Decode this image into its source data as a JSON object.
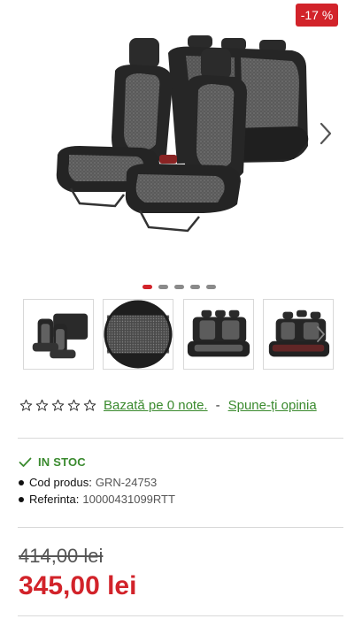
{
  "gallery": {
    "discount_badge": "-17 %",
    "main_image": "car-seat-covers-full-set",
    "next_icon": "chevron-right-icon",
    "dots_count": 5,
    "active_dot": 0,
    "thumbnails": [
      "seat-set-thumb",
      "fabric-pattern-thumb",
      "rear-bench-thumb",
      "rear-bench-angle-thumb"
    ],
    "thumb_next_icon": "chevron-right-icon"
  },
  "rating": {
    "stars": 5,
    "based_on_label": "Bazată pe 0 note.",
    "separator": "-",
    "review_link": "Spune-ți opinia"
  },
  "stock": {
    "status": "IN STOC",
    "status_color": "#3a8a2e"
  },
  "specs": {
    "code_label": "Cod produs:",
    "code_value": "GRN-24753",
    "ref_label": "Referinta:",
    "ref_value": "10000431099RTT"
  },
  "price": {
    "old": "414,00 lei",
    "new": "345,00 lei",
    "accent_color": "#d2232a"
  }
}
